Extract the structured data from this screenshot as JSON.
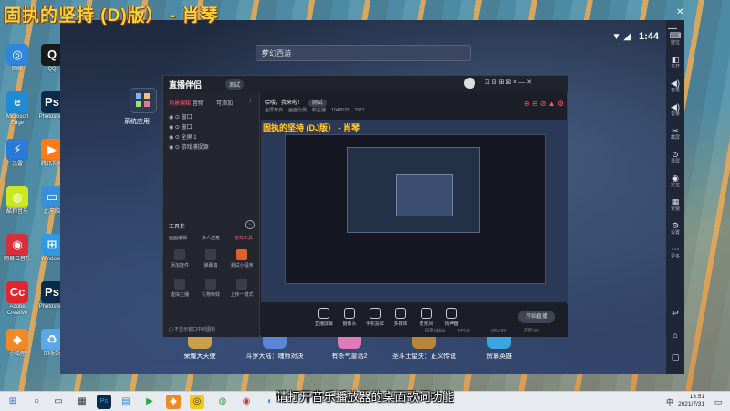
{
  "overlay_title": "固执的坚持 (D)版） - 肖琴",
  "desktop_icons": [
    {
      "label": "网络",
      "color": "#2e86de",
      "glyph": "◎"
    },
    {
      "label": "QQ",
      "color": "#1a1a1a",
      "glyph": "Q"
    },
    {
      "label": "Microsoft Edge",
      "color": "#1f8ad6",
      "glyph": "e"
    },
    {
      "label": "Photoshop",
      "color": "#0c2a4a",
      "glyph": "Ps"
    },
    {
      "label": "迅雷",
      "color": "#2a7bd8",
      "glyph": "⚡"
    },
    {
      "label": "腾讯视频",
      "color": "#ff7b1a",
      "glyph": "▶"
    },
    {
      "label": "酷狗音乐",
      "color": "#c9e820",
      "glyph": "◍"
    },
    {
      "label": "此电脑",
      "color": "#3a8fd9",
      "glyph": "▭"
    },
    {
      "label": "网易云音乐",
      "color": "#d8303a",
      "glyph": "◉"
    },
    {
      "label": "Windows",
      "color": "#2e9ae6",
      "glyph": "⊞"
    },
    {
      "label": "Adobe Creative",
      "color": "#e3262e",
      "glyph": "Cc"
    },
    {
      "label": "Photoshop",
      "color": "#0c2a4a",
      "glyph": "Ps"
    },
    {
      "label": "小狐狸",
      "color": "#f08a24",
      "glyph": "◆"
    },
    {
      "label": "回收站",
      "color": "#5aa9e6",
      "glyph": "♻"
    }
  ],
  "emulator": {
    "time": "1:44",
    "search_text": "梦幻西游",
    "system_app_label": "系统应用",
    "bottom_apps": [
      {
        "label": "荣耀大天使",
        "color": "#c9a14a"
      },
      {
        "label": "斗罗大陆：魂师对决",
        "color": "#5a86d8"
      },
      {
        "label": "有杀气童话2",
        "color": "#e07ab8"
      },
      {
        "label": "圣斗士星矢：正义传说",
        "color": "#b8863a"
      },
      {
        "label": "贸幂英雄",
        "color": "#3aa8e0"
      }
    ],
    "toolbar": [
      {
        "icon": "⌨",
        "label": "键位"
      },
      {
        "icon": "◧",
        "label": "多开"
      },
      {
        "icon": "◀)",
        "label": "音量"
      },
      {
        "icon": "◀)",
        "label": "音量"
      },
      {
        "icon": "✂",
        "label": "截屏"
      },
      {
        "icon": "⊙",
        "label": "录屏"
      },
      {
        "icon": "◉",
        "label": "定位"
      },
      {
        "icon": "▦",
        "label": "安装"
      },
      {
        "icon": "⚙",
        "label": "设置"
      },
      {
        "icon": "⋯",
        "label": "更多"
      },
      {
        "icon": "↩",
        "label": ""
      },
      {
        "icon": "⌂",
        "label": ""
      },
      {
        "icon": "▢",
        "label": ""
      }
    ]
  },
  "livebroadcast": {
    "logo": "直播伴侣",
    "badge": "测试",
    "tabs": [
      "场景编辑",
      "音频",
      "可添加",
      "+"
    ],
    "sources": [
      "窗口",
      "窗口",
      "全屏 1",
      "游戏捕捉源"
    ],
    "tools_title": "工具栏",
    "tool_tabs": [
      "画面编辑",
      "多人连麦",
      "游戏工具"
    ],
    "tools": [
      "添加挂件",
      "弹幕墙",
      "测试小程序",
      "虚拟主播",
      "礼物特效",
      "上传一键式"
    ],
    "hint": "不显示窗口中的图标",
    "greeting": "哈喽，我来啦！",
    "greeting_badge": "测试",
    "stats": [
      "全屏开启",
      "画面比例",
      "新主播",
      "1048033",
      "7971"
    ],
    "preview_title": "固执的坚持 (DJ版） - 肖琴",
    "controls": [
      "直播屏幕",
      "摄像头",
      "手机投屏",
      "多媒体",
      "麦克风",
      "扬声器"
    ],
    "start_label": "开始直播",
    "bottom_stats": [
      "码率:0kbps",
      "FPS:0",
      "CPU:0%",
      "内存:0%"
    ]
  },
  "subtitle": "请打开音乐播放器的桌面歌词功能",
  "taskbar": {
    "lang": "中",
    "time": "13:51",
    "date": "2021/7/31"
  }
}
